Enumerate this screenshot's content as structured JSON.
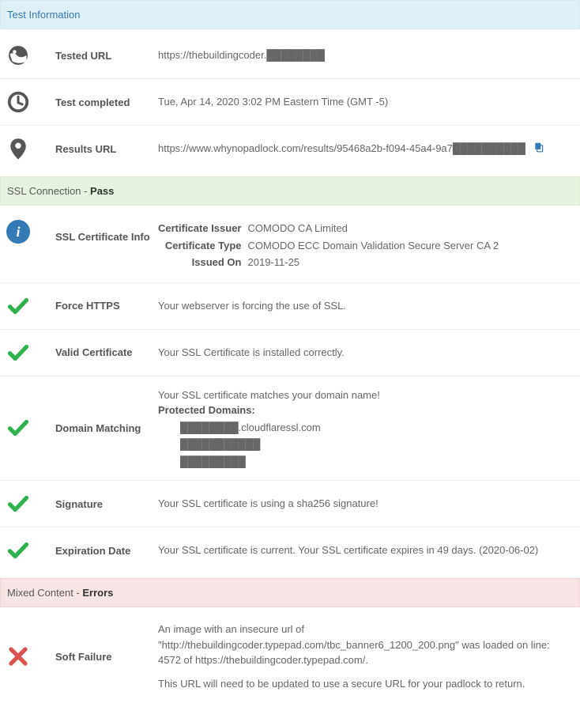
{
  "sections": {
    "testInfo": {
      "title": "Test Information"
    },
    "ssl": {
      "titlePrefix": "SSL Connection - ",
      "status": "Pass"
    },
    "mixed": {
      "titlePrefix": "Mixed Content - ",
      "status": "Errors"
    }
  },
  "testInfo": {
    "testedUrl": {
      "label": "Tested URL",
      "value": "https://thebuildingcoder.████████"
    },
    "completed": {
      "label": "Test completed",
      "value": "Tue, Apr 14, 2020 3:02 PM Eastern Time (GMT -5)"
    },
    "resultsUrl": {
      "label": "Results URL",
      "value": "https://www.whynopadlock.com/results/95468a2b-f094-45a4-9a7██████████"
    }
  },
  "ssl": {
    "certInfo": {
      "label": "SSL Certificate Info",
      "issuerLabel": "Certificate Issuer",
      "issuer": "COMODO CA Limited",
      "typeLabel": "Certificate Type",
      "type": "COMODO ECC Domain Validation Secure Server CA 2",
      "issuedOnLabel": "Issued On",
      "issuedOn": "2019-11-25"
    },
    "forceHttps": {
      "label": "Force HTTPS",
      "value": "Your webserver is forcing the use of SSL."
    },
    "validCert": {
      "label": "Valid Certificate",
      "value": "Your SSL Certificate is installed correctly."
    },
    "domainMatch": {
      "label": "Domain Matching",
      "line1": "Your SSL certificate matches your domain name!",
      "protectedLabel": "Protected Domains:",
      "d1": "████████.cloudflaressl.com",
      "d2": "███████████",
      "d3": "█████████"
    },
    "signature": {
      "label": "Signature",
      "value": "Your SSL certificate is using a sha256 signature!"
    },
    "expiration": {
      "label": "Expiration Date",
      "value": "Your SSL certificate is current. Your SSL certificate expires in 49 days. (2020-06-02)"
    }
  },
  "mixed": {
    "softFailure": {
      "label": "Soft Failure",
      "line1": "An image with an insecure url of \"http://thebuildingcoder.typepad.com/tbc_banner6_1200_200.png\" was loaded on line: 4572 of https://thebuildingcoder.typepad.com/.",
      "line2": "This URL will need to be updated to use a secure URL for your padlock to return."
    }
  }
}
